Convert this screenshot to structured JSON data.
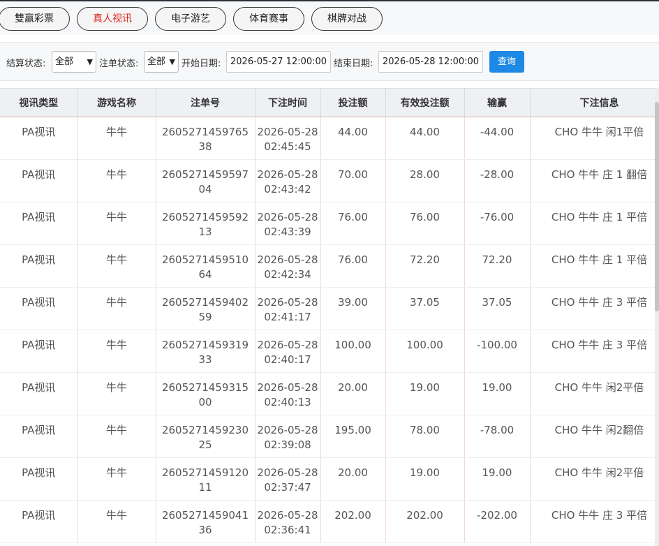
{
  "tabs": [
    {
      "label": "雙赢彩票",
      "active": false
    },
    {
      "label": "真人视讯",
      "active": true
    },
    {
      "label": "电子游艺",
      "active": false
    },
    {
      "label": "体育赛事",
      "active": false
    },
    {
      "label": "棋牌对战",
      "active": false
    }
  ],
  "filters": {
    "settle_label": "结算状态:",
    "settle_value": "全部",
    "bet_label": "注单状态:",
    "bet_value": "全部",
    "start_label": "开始日期:",
    "start_value": "2026-05-27 12:00:00",
    "end_label": "结束日期:",
    "end_value": "2026-05-28 12:00:00",
    "query_label": "查询"
  },
  "table": {
    "headers": [
      "视讯类型",
      "游戏名称",
      "注单号",
      "下注时间",
      "投注额",
      "有效投注额",
      "输赢",
      "下注信息"
    ],
    "rows": [
      [
        "PA视讯",
        "牛牛",
        "260527145976538",
        "2026-05-28 02:45:45",
        "44.00",
        "44.00",
        "-44.00",
        "CHO 牛牛 闲1平倍"
      ],
      [
        "PA视讯",
        "牛牛",
        "260527145959704",
        "2026-05-28 02:43:42",
        "70.00",
        "28.00",
        "-28.00",
        "CHO 牛牛 庄 1 翻倍"
      ],
      [
        "PA视讯",
        "牛牛",
        "260527145959213",
        "2026-05-28 02:43:39",
        "76.00",
        "76.00",
        "-76.00",
        "CHO 牛牛 庄 1 平倍"
      ],
      [
        "PA视讯",
        "牛牛",
        "260527145951064",
        "2026-05-28 02:42:34",
        "76.00",
        "72.20",
        "72.20",
        "CHO 牛牛 庄 1 平倍"
      ],
      [
        "PA视讯",
        "牛牛",
        "260527145940259",
        "2026-05-28 02:41:17",
        "39.00",
        "37.05",
        "37.05",
        "CHO 牛牛 庄 3 平倍"
      ],
      [
        "PA视讯",
        "牛牛",
        "260527145931933",
        "2026-05-28 02:40:17",
        "100.00",
        "100.00",
        "-100.00",
        "CHO 牛牛 庄 3 平倍"
      ],
      [
        "PA视讯",
        "牛牛",
        "260527145931500",
        "2026-05-28 02:40:13",
        "20.00",
        "19.00",
        "19.00",
        "CHO 牛牛 闲2平倍"
      ],
      [
        "PA视讯",
        "牛牛",
        "260527145923025",
        "2026-05-28 02:39:08",
        "195.00",
        "78.00",
        "-78.00",
        "CHO 牛牛 闲2翻倍"
      ],
      [
        "PA视讯",
        "牛牛",
        "260527145912011",
        "2026-05-28 02:37:47",
        "20.00",
        "19.00",
        "19.00",
        "CHO 牛牛 闲2平倍"
      ],
      [
        "PA视讯",
        "牛牛",
        "260527145904136",
        "2026-05-28 02:36:41",
        "202.00",
        "202.00",
        "-202.00",
        "CHO 牛牛 庄 3 平倍"
      ]
    ]
  },
  "colors": {
    "accent": "#1e88e5",
    "active_tab": "#e0261b"
  }
}
